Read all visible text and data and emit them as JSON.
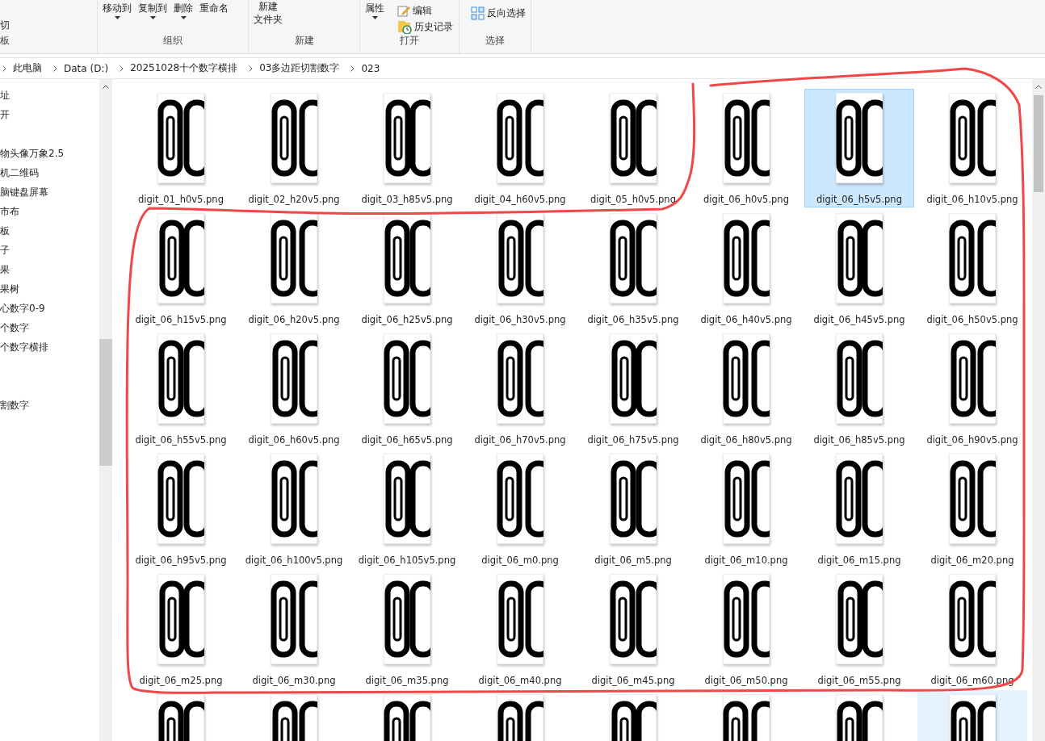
{
  "ribbon": {
    "groups": [
      {
        "label": "板",
        "items": [
          {
            "kind": "small",
            "label": "切"
          }
        ]
      },
      {
        "label": "组织",
        "items": [
          {
            "kind": "large",
            "lines": [
              "移动到"
            ],
            "caret": true
          },
          {
            "kind": "large",
            "lines": [
              "复制到"
            ],
            "caret": true
          },
          {
            "kind": "large",
            "lines": [
              "删除"
            ],
            "caret": true
          },
          {
            "kind": "large",
            "lines": [
              "重命名"
            ],
            "caret": false
          }
        ]
      },
      {
        "label": "新建",
        "items": [
          {
            "kind": "large",
            "lines": [
              "新建",
              "文件夹"
            ],
            "caret": false
          }
        ]
      },
      {
        "label": "打开",
        "items": [
          {
            "kind": "large",
            "lines": [
              "属性"
            ],
            "caret": true
          },
          {
            "kind": "stack",
            "items": [
              {
                "label": "编辑"
              },
              {
                "label": "历史记录"
              }
            ]
          }
        ]
      },
      {
        "label": "选择",
        "items": [
          {
            "kind": "stack",
            "items": [
              {
                "label": "反向选择"
              }
            ]
          }
        ]
      }
    ]
  },
  "address": {
    "crumbs": [
      "此电脑",
      "Data (D:)",
      "20251028十个数字横排",
      "03多边距切割数字",
      "023"
    ]
  },
  "sidebar": {
    "items": [
      {
        "label": "址"
      },
      {
        "label": "开"
      },
      {
        "label": "物头像万象2.5"
      },
      {
        "label": "机二维码"
      },
      {
        "label": "脑键盘屏幕"
      },
      {
        "label": "市布"
      },
      {
        "label": "板"
      },
      {
        "label": "子"
      },
      {
        "label": "果"
      },
      {
        "label": "果树"
      },
      {
        "label": "心数字0-9"
      },
      {
        "label": "个数字"
      },
      {
        "label": "个数字横排"
      },
      {
        "label": "割数字"
      }
    ]
  },
  "files": [
    {
      "kind": "file",
      "name": "digit_01_h0v5.png",
      "selected": false,
      "hot": false
    },
    {
      "kind": "file",
      "name": "digit_02_h20v5.png",
      "selected": false,
      "hot": false
    },
    {
      "kind": "file",
      "name": "digit_03_h85v5.png",
      "selected": false,
      "hot": false
    },
    {
      "kind": "file",
      "name": "digit_04_h60v5.png",
      "selected": false,
      "hot": false
    },
    {
      "kind": "file",
      "name": "digit_05_h0v5.png",
      "selected": false,
      "hot": false
    },
    {
      "kind": "file",
      "name": "digit_06_h0v5.png",
      "selected": false,
      "hot": false
    },
    {
      "kind": "file",
      "name": "digit_06_h5v5.png",
      "selected": true,
      "hot": false
    },
    {
      "kind": "file",
      "name": "digit_06_h10v5.png",
      "selected": false,
      "hot": false
    },
    {
      "kind": "file",
      "name": "digit_06_h15v5.png",
      "selected": false,
      "hot": false
    },
    {
      "kind": "file",
      "name": "digit_06_h20v5.png",
      "selected": false,
      "hot": false
    },
    {
      "kind": "file",
      "name": "digit_06_h25v5.png",
      "selected": false,
      "hot": false
    },
    {
      "kind": "file",
      "name": "digit_06_h30v5.png",
      "selected": false,
      "hot": false
    },
    {
      "kind": "file",
      "name": "digit_06_h35v5.png",
      "selected": false,
      "hot": false
    },
    {
      "kind": "file",
      "name": "digit_06_h40v5.png",
      "selected": false,
      "hot": false
    },
    {
      "kind": "file",
      "name": "digit_06_h45v5.png",
      "selected": false,
      "hot": false
    },
    {
      "kind": "file",
      "name": "digit_06_h50v5.png",
      "selected": false,
      "hot": false
    },
    {
      "kind": "file",
      "name": "digit_06_h55v5.png",
      "selected": false,
      "hot": false
    },
    {
      "kind": "file",
      "name": "digit_06_h60v5.png",
      "selected": false,
      "hot": false
    },
    {
      "kind": "file",
      "name": "digit_06_h65v5.png",
      "selected": false,
      "hot": false
    },
    {
      "kind": "file",
      "name": "digit_06_h70v5.png",
      "selected": false,
      "hot": false
    },
    {
      "kind": "file",
      "name": "digit_06_h75v5.png",
      "selected": false,
      "hot": false
    },
    {
      "kind": "file",
      "name": "digit_06_h80v5.png",
      "selected": false,
      "hot": false
    },
    {
      "kind": "file",
      "name": "digit_06_h85v5.png",
      "selected": false,
      "hot": false
    },
    {
      "kind": "file",
      "name": "digit_06_h90v5.png",
      "selected": false,
      "hot": false
    },
    {
      "kind": "file",
      "name": "digit_06_h95v5.png",
      "selected": false,
      "hot": false
    },
    {
      "kind": "file",
      "name": "digit_06_h100v5.png",
      "selected": false,
      "hot": false
    },
    {
      "kind": "file",
      "name": "digit_06_h105v5.png",
      "selected": false,
      "hot": false
    },
    {
      "kind": "file",
      "name": "digit_06_m0.png",
      "selected": false,
      "hot": false
    },
    {
      "kind": "file",
      "name": "digit_06_m5.png",
      "selected": false,
      "hot": false
    },
    {
      "kind": "file",
      "name": "digit_06_m10.png",
      "selected": false,
      "hot": false
    },
    {
      "kind": "file",
      "name": "digit_06_m15.png",
      "selected": false,
      "hot": false
    },
    {
      "kind": "file",
      "name": "digit_06_m20.png",
      "selected": false,
      "hot": false
    },
    {
      "kind": "file",
      "name": "digit_06_m25.png",
      "selected": false,
      "hot": false
    },
    {
      "kind": "file",
      "name": "digit_06_m30.png",
      "selected": false,
      "hot": false
    },
    {
      "kind": "file",
      "name": "digit_06_m35.png",
      "selected": false,
      "hot": false
    },
    {
      "kind": "file",
      "name": "digit_06_m40.png",
      "selected": false,
      "hot": false
    },
    {
      "kind": "file",
      "name": "digit_06_m45.png",
      "selected": false,
      "hot": false
    },
    {
      "kind": "file",
      "name": "digit_06_m50.png",
      "selected": false,
      "hot": false
    },
    {
      "kind": "file",
      "name": "digit_06_m55.png",
      "selected": false,
      "hot": false
    },
    {
      "kind": "file",
      "name": "digit_06_m60.png",
      "selected": false,
      "hot": false
    },
    {
      "kind": "picture",
      "selected": false,
      "hot": false
    },
    {
      "kind": "picture",
      "selected": false,
      "hot": false
    },
    {
      "kind": "picture",
      "selected": false,
      "hot": false
    },
    {
      "kind": "picture",
      "selected": false,
      "hot": false
    },
    {
      "kind": "picture",
      "selected": false,
      "hot": false
    },
    {
      "kind": "picture",
      "selected": false,
      "hot": false
    },
    {
      "kind": "picture",
      "selected": false,
      "hot": false
    },
    {
      "kind": "picture",
      "selected": false,
      "hot": true
    }
  ]
}
